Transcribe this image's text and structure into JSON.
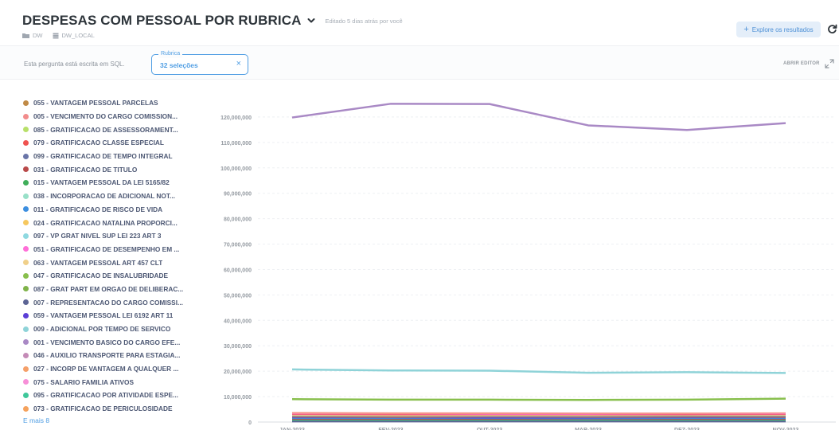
{
  "header": {
    "title": "DESPESAS COM PESSOAL POR RUBRICA",
    "edited": "Editado 5 dias atrás por você",
    "breadcrumbs": [
      {
        "label": "DW",
        "icon": "folder-icon"
      },
      {
        "label": "DW_LOCAL",
        "icon": "database-icon"
      }
    ],
    "explore_label": "Explore os resultados"
  },
  "filterbar": {
    "sql_note": "Esta pergunta está escrita em SQL.",
    "filter_label": "Rubrica",
    "filter_value": "32 seleções",
    "open_editor": "ABRIR EDITOR"
  },
  "legend": {
    "items": [
      {
        "label": "055 - VANTAGEM PESSOAL PARCELAS",
        "color": "#c08a47"
      },
      {
        "label": "005 - VENCIMENTO DO CARGO COMISSION...",
        "color": "#f28c8c"
      },
      {
        "label": "085 - GRATIFICACAO DE ASSESSORAMENT...",
        "color": "#b8e06a"
      },
      {
        "label": "079 - GRATIFICACAO CLASSE ESPECIAL",
        "color": "#ef5350"
      },
      {
        "label": "099 - GRATIFICACAO DE TEMPO INTEGRAL",
        "color": "#6a75a8"
      },
      {
        "label": "031 - GRATIFICACAO DE TITULO",
        "color": "#b94a4a"
      },
      {
        "label": "015 - VANTAGEM PESSOAL DA LEI 5165/82",
        "color": "#3fae5a"
      },
      {
        "label": "038 - INCORPORACAO DE ADICIONAL NOT...",
        "color": "#98e0c8"
      },
      {
        "label": "011 - GRATIFICACAO DE RISCO DE VIDA",
        "color": "#3d8fe0"
      },
      {
        "label": "024 - GRATIFICACAO NATALINA PROPORCI...",
        "color": "#f6c85f"
      },
      {
        "label": "097 - VP GRAT NIVEL SUP LEI 223 ART 3",
        "color": "#8fd9e0"
      },
      {
        "label": "051 - GRATIFICACAO DE DESEMPENHO EM ...",
        "color": "#ff6fd8"
      },
      {
        "label": "063 - VANTAGEM PESSOAL ART 457 CLT",
        "color": "#f0d08a"
      },
      {
        "label": "047 - GRATIFICACAO DE INSALUBRIDADE",
        "color": "#88bf4d"
      },
      {
        "label": "087 - GRAT PART EM ORGAO DE DELIBERAC...",
        "color": "#7fb34a"
      },
      {
        "label": "007 - REPRESENTACAO DO CARGO COMISSI...",
        "color": "#5c6494"
      },
      {
        "label": "059 - VANTAGEM PESSOAL LEI 6192 ART 11",
        "color": "#5b3fd6"
      },
      {
        "label": "009 - ADICIONAL POR TEMPO DE SERVICO",
        "color": "#8fd3d8"
      },
      {
        "label": "001 - VENCIMENTO BASICO DO CARGO EFE...",
        "color": "#a989c5"
      },
      {
        "label": "046 - AUXILIO TRANSPORTE PARA ESTAGIA...",
        "color": "#c48bb7"
      },
      {
        "label": "027 - INCORP DE VANTAGEM A QUALQUER ...",
        "color": "#f5a06a"
      },
      {
        "label": "075 - SALARIO FAMILIA ATIVOS",
        "color": "#f78fd8"
      },
      {
        "label": "095 - GRATIFICACAO POR ATIVIDADE ESPE...",
        "color": "#3fc79a"
      },
      {
        "label": "073 - GRATIFICACAO DE PERICULOSIDADE",
        "color": "#f5a25d"
      }
    ],
    "more_label": "E mais 8"
  },
  "chart_data": {
    "type": "line",
    "categories": [
      "JAN-2023",
      "FEV-2023",
      "OUT-2023",
      "MAR-2023",
      "DEZ-2023",
      "NOV-2023"
    ],
    "ylim": [
      0,
      130000000
    ],
    "yticks": [
      0,
      10000000,
      20000000,
      30000000,
      40000000,
      50000000,
      60000000,
      70000000,
      80000000,
      90000000,
      100000000,
      110000000,
      120000000
    ],
    "ytick_labels": [
      "0",
      "10,000,000",
      "20,000,000",
      "30,000,000",
      "40,000,000",
      "50,000,000",
      "60,000,000",
      "70,000,000",
      "80,000,000",
      "90,000,000",
      "100,000,000",
      "110,000,000",
      "120,000,000"
    ],
    "grid": true,
    "series": [
      {
        "name": "001 - VENCIMENTO BASICO DO CARGO EFE...",
        "color": "#a989c5",
        "values": [
          119800000,
          125200000,
          125100000,
          116700000,
          114900000,
          117600000
        ]
      },
      {
        "name": "009 - ADICIONAL POR TEMPO DE SERVICO",
        "color": "#8fd3d8",
        "values": [
          20700000,
          20300000,
          20200000,
          19400000,
          19600000,
          19300000
        ]
      },
      {
        "name": "047 - GRATIFICACAO DE INSALUBRIDADE",
        "color": "#88bf4d",
        "values": [
          9000000,
          8800000,
          8800000,
          8700000,
          8800000,
          9200000
        ]
      },
      {
        "name": "005 - VENCIMENTO DO CARGO COMISSION...",
        "color": "#f28c8c",
        "values": [
          3600000,
          3500000,
          3500000,
          3400000,
          3400000,
          3500000
        ]
      },
      {
        "name": "027 - INCORP DE VANTAGEM A QUALQUER ...",
        "color": "#f5a06a",
        "values": [
          3300000,
          3200000,
          3200000,
          3100000,
          3200000,
          3200000
        ]
      },
      {
        "name": "051 - GRATIFICACAO DE DESEMPENHO EM ...",
        "color": "#ff6fd8",
        "values": [
          3000000,
          2900000,
          2900000,
          2900000,
          2900000,
          3000000
        ]
      },
      {
        "name": "079 - GRATIFICACAO CLASSE ESPECIAL",
        "color": "#ef5350",
        "values": [
          2700000,
          2700000,
          2600000,
          2600000,
          2700000,
          2700000
        ]
      },
      {
        "name": "063 - VANTAGEM PESSOAL ART 457 CLT",
        "color": "#f0d08a",
        "values": [
          2500000,
          2400000,
          2400000,
          2400000,
          2400000,
          2500000
        ]
      },
      {
        "name": "099 - GRATIFICACAO DE TEMPO INTEGRAL",
        "color": "#6a75a8",
        "values": [
          2100000,
          2000000,
          2000000,
          2000000,
          2100000,
          2100000
        ]
      },
      {
        "name": "055 - VANTAGEM PESSOAL PARCELAS",
        "color": "#c08a47",
        "values": [
          1800000,
          1800000,
          1700000,
          1700000,
          1800000,
          1800000
        ]
      },
      {
        "name": "059 - VANTAGEM PESSOAL LEI 6192 ART 11",
        "color": "#5b3fd6",
        "values": [
          1500000,
          1400000,
          1500000,
          1400000,
          1500000,
          1400000
        ]
      },
      {
        "name": "011 - GRATIFICACAO DE RISCO DE VIDA",
        "color": "#3d8fe0",
        "values": [
          1200000,
          1200000,
          1100000,
          1100000,
          1200000,
          1200000
        ]
      },
      {
        "name": "031 - GRATIFICACAO DE TITULO",
        "color": "#b94a4a",
        "values": [
          900000,
          900000,
          900000,
          800000,
          900000,
          900000
        ]
      },
      {
        "name": "015 - VANTAGEM PESSOAL DA LEI 5165/82",
        "color": "#3fae5a",
        "values": [
          600000,
          600000,
          600000,
          600000,
          600000,
          600000
        ]
      },
      {
        "name": "095 - GRATIFICACAO POR ATIVIDADE ESPE...",
        "color": "#3fc79a",
        "values": [
          400000,
          400000,
          400000,
          400000,
          400000,
          400000
        ]
      },
      {
        "name": "007 - REPRESENTACAO DO CARGO COMISSI...",
        "color": "#5c6494",
        "values": [
          200000,
          200000,
          200000,
          200000,
          200000,
          200000
        ]
      }
    ]
  }
}
